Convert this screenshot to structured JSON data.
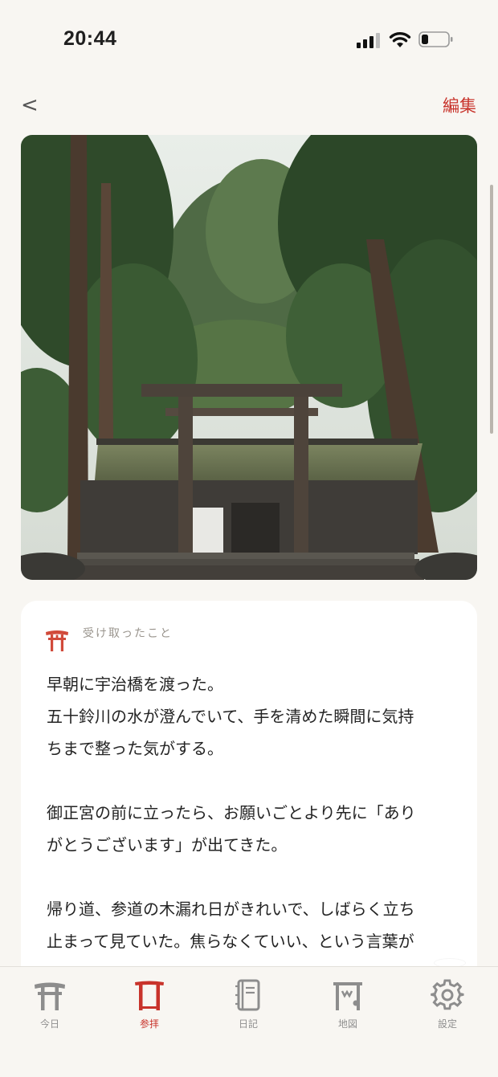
{
  "status_bar": {
    "time": "20:44"
  },
  "nav": {
    "back_label": "<",
    "edit_label": "編集"
  },
  "hero": {
    "image": "shrine-gate-with-cedar-trees"
  },
  "card": {
    "icon": "torii-icon",
    "label": "受け取ったこと",
    "paragraphs": [
      [
        "早朝に宇治橋を渡った。",
        "五十鈴川の水が澄んでいて、手を清めた瞬間に気持",
        "ちまで整った気がする。"
      ],
      [
        "御正宮の前に立ったら、お願いごとより先に「あり",
        "がとうございます」が出てきた。"
      ],
      [
        "帰り道、参道の木漏れ日がきれいで、しばらく立ち",
        "止まって見ていた。焦らなくていい、という言葉が"
      ]
    ]
  },
  "tabs": [
    {
      "label": "今日",
      "icon": "torii-icon",
      "active": false
    },
    {
      "label": "参拝",
      "icon": "gate-icon",
      "active": true
    },
    {
      "label": "日記",
      "icon": "notebook-icon",
      "active": false
    },
    {
      "label": "地図",
      "icon": "map-icon",
      "active": false
    },
    {
      "label": "設定",
      "icon": "gear-icon",
      "active": false
    }
  ],
  "colors": {
    "accent": "#c8332b",
    "background": "#f8f6f2",
    "card": "#ffffff",
    "inactive": "#8f8f8f"
  }
}
